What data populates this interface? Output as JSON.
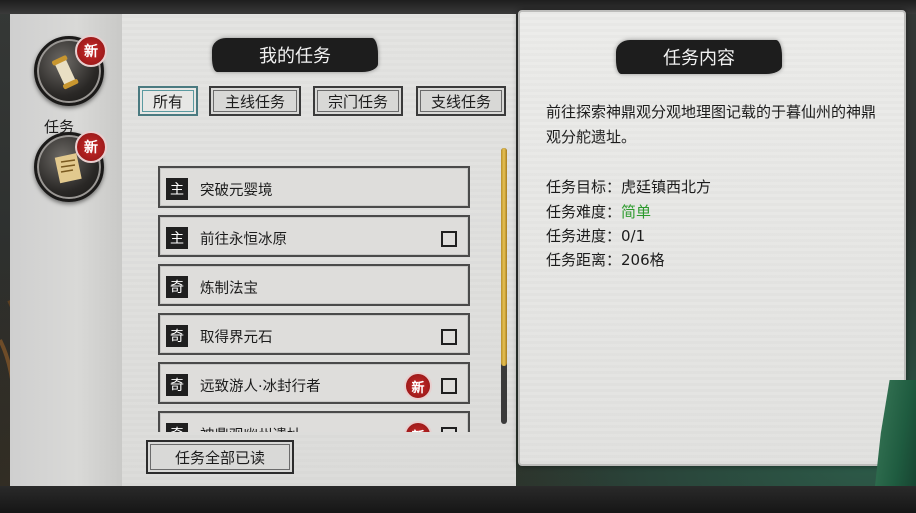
{
  "sidebar": {
    "tabs": [
      {
        "label": "任务",
        "badge": "新",
        "icon": "scroll-icon"
      },
      {
        "label": "",
        "badge": "新",
        "icon": "letter-icon"
      }
    ]
  },
  "list_panel": {
    "title": "我的任务",
    "filters": [
      "所有",
      "主线任务",
      "宗门任务",
      "支线任务"
    ],
    "active_filter": "所有",
    "quests": [
      {
        "tag": "主",
        "name": "突破元婴境",
        "checkbox": false,
        "new": false
      },
      {
        "tag": "主",
        "name": "前往永恒冰原",
        "checkbox": true,
        "new": false
      },
      {
        "tag": "奇",
        "name": "炼制法宝",
        "checkbox": false,
        "new": false
      },
      {
        "tag": "奇",
        "name": "取得界元石",
        "checkbox": true,
        "new": false
      },
      {
        "tag": "奇",
        "name": "远致游人·冰封行者",
        "checkbox": true,
        "new": true
      },
      {
        "tag": "奇",
        "name": "神鼎观幽州遗址",
        "checkbox": true,
        "new": true
      }
    ],
    "new_badge": "新",
    "read_all_label": "任务全部已读"
  },
  "detail_panel": {
    "title": "任务内容",
    "description": "前往探索神鼎观分观地理图记载的于暮仙州的神鼎观分舵遗址。",
    "target_label": "任务目标：",
    "target_value": "虎廷镇西北方",
    "difficulty_label": "任务难度：",
    "difficulty_value": "简单",
    "progress_label": "任务进度：",
    "progress_value": "0/1",
    "distance_label": "任务距离：",
    "distance_value": "206格"
  },
  "colors": {
    "difficulty_easy": "#2c9a2c",
    "badge_red": "#c92a2a",
    "scroll_gold": "#e8c253"
  }
}
